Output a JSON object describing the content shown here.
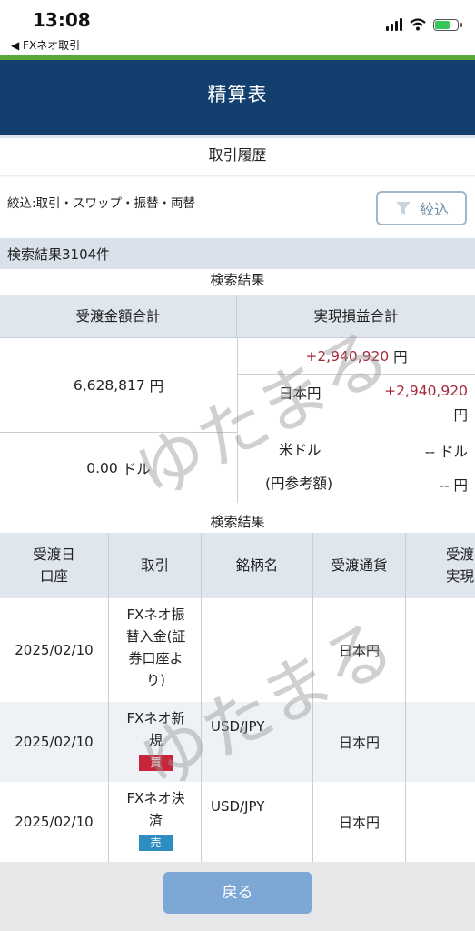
{
  "status_bar": {
    "time": "13:08",
    "back_app": "◀ FXネオ取引"
  },
  "header": {
    "title": "精算表"
  },
  "section": {
    "title": "取引履歴"
  },
  "filter": {
    "label": "絞込:取引・スワップ・振替・両替",
    "button_label": "絞込"
  },
  "results": {
    "count_label": "検索結果3104件",
    "sub_title": "検索結果"
  },
  "summary": {
    "col1_header": "受渡金額合計",
    "col2_header": "実現損益合計",
    "delivery_jpy_value": "6,628,817",
    "delivery_jpy_unit": "円",
    "delivery_usd_value": "0.00",
    "delivery_usd_unit": "ドル",
    "total_pl_value": "+2,940,920",
    "total_pl_unit": "円",
    "jpy_label": "日本円",
    "jpy_value": "+2,940,920",
    "jpy_unit": "円",
    "usd_label": "米ドル",
    "usd_value": "--",
    "usd_unit": "ドル",
    "ref_label": "(円参考額)",
    "ref_value": "--",
    "ref_unit": "円"
  },
  "detail": {
    "sub_title": "検索結果",
    "headers": {
      "date_line1": "受渡日",
      "date_line2": "口座",
      "trade": "取引",
      "symbol": "銘柄名",
      "currency": "受渡通貨",
      "partial_line1": "受渡",
      "partial_line2": "実現"
    },
    "rows": [
      {
        "date": "2025/02/10",
        "trade_l1": "FXネオ振",
        "trade_l2": "替入金(証",
        "trade_l3": "券口座よ",
        "trade_l4": "り)",
        "symbol": "",
        "currency": "日本円",
        "badge": ""
      },
      {
        "date": "2025/02/10",
        "trade_l1": "FXネオ新",
        "trade_l2": "規",
        "symbol": "USD/JPY",
        "currency": "日本円",
        "badge": "買"
      },
      {
        "date": "2025/02/10",
        "trade_l1": "FXネオ決",
        "trade_l2": "済",
        "symbol": "USD/JPY",
        "currency": "日本円",
        "badge": "売"
      }
    ]
  },
  "footer": {
    "back_label": "戻る"
  },
  "watermark": {
    "text": "ゆたまる"
  },
  "colors": {
    "header_bg": "#123f6e",
    "accent_green": "#5aa83a",
    "profit": "#a3283a",
    "buy": "#c8243a",
    "sell": "#2e8ec2",
    "back_button": "#7da8d6"
  }
}
